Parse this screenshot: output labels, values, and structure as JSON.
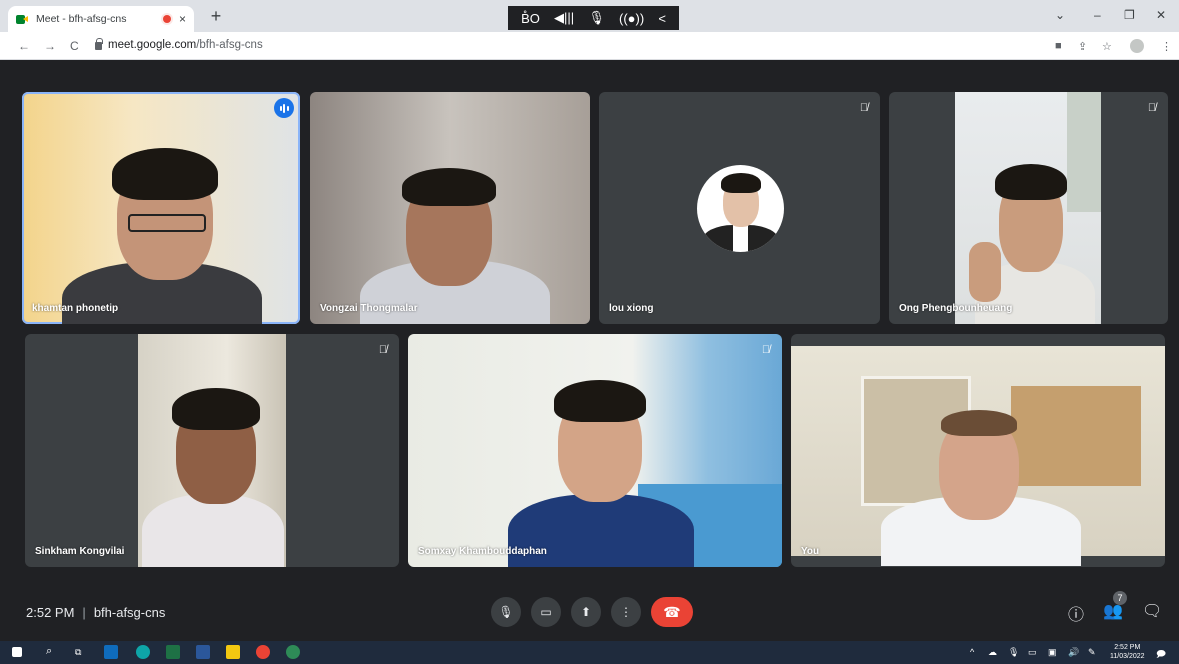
{
  "browser": {
    "tab_title": "Meet - bfh-afsg-cns",
    "tab_close": "×",
    "new_tab": "+",
    "url_host": "meet.google.com",
    "url_path": "/bfh-afsg-cns",
    "win_controls": {
      "chevron": "⌄",
      "minimize": "–",
      "restore": "❐",
      "close": "✕"
    }
  },
  "float_toolbar": [
    "B̊O",
    "◀|||",
    "🎙",
    "((●))",
    "<"
  ],
  "participants": [
    {
      "name": "khamtan phonetip",
      "muted": false,
      "speaking": true
    },
    {
      "name": "Vongzai Thongmalar",
      "muted": false,
      "speaking": false
    },
    {
      "name": "lou xiong",
      "muted": true,
      "speaking": false
    },
    {
      "name": "Ong Phengbounheuang",
      "muted": true,
      "speaking": false
    },
    {
      "name": "Sinkham Kongvilai",
      "muted": true,
      "speaking": false
    },
    {
      "name": "Somxay Khambouddaphan",
      "muted": true,
      "speaking": false
    },
    {
      "name": "You",
      "muted": false,
      "speaking": false
    }
  ],
  "bottom_bar": {
    "time": "2:52 PM",
    "separator": "|",
    "meeting_code": "bfh-afsg-cns",
    "people_count": "7"
  },
  "taskbar": {
    "clock_time": "2:52 PM",
    "clock_date": "11/03/2022"
  },
  "colors": {
    "meet_bg": "#202124",
    "tile_bg": "#3c4043",
    "end_call": "#ea4335",
    "speaking": "#1a73e8",
    "taskbar": "#1f2b3d"
  }
}
